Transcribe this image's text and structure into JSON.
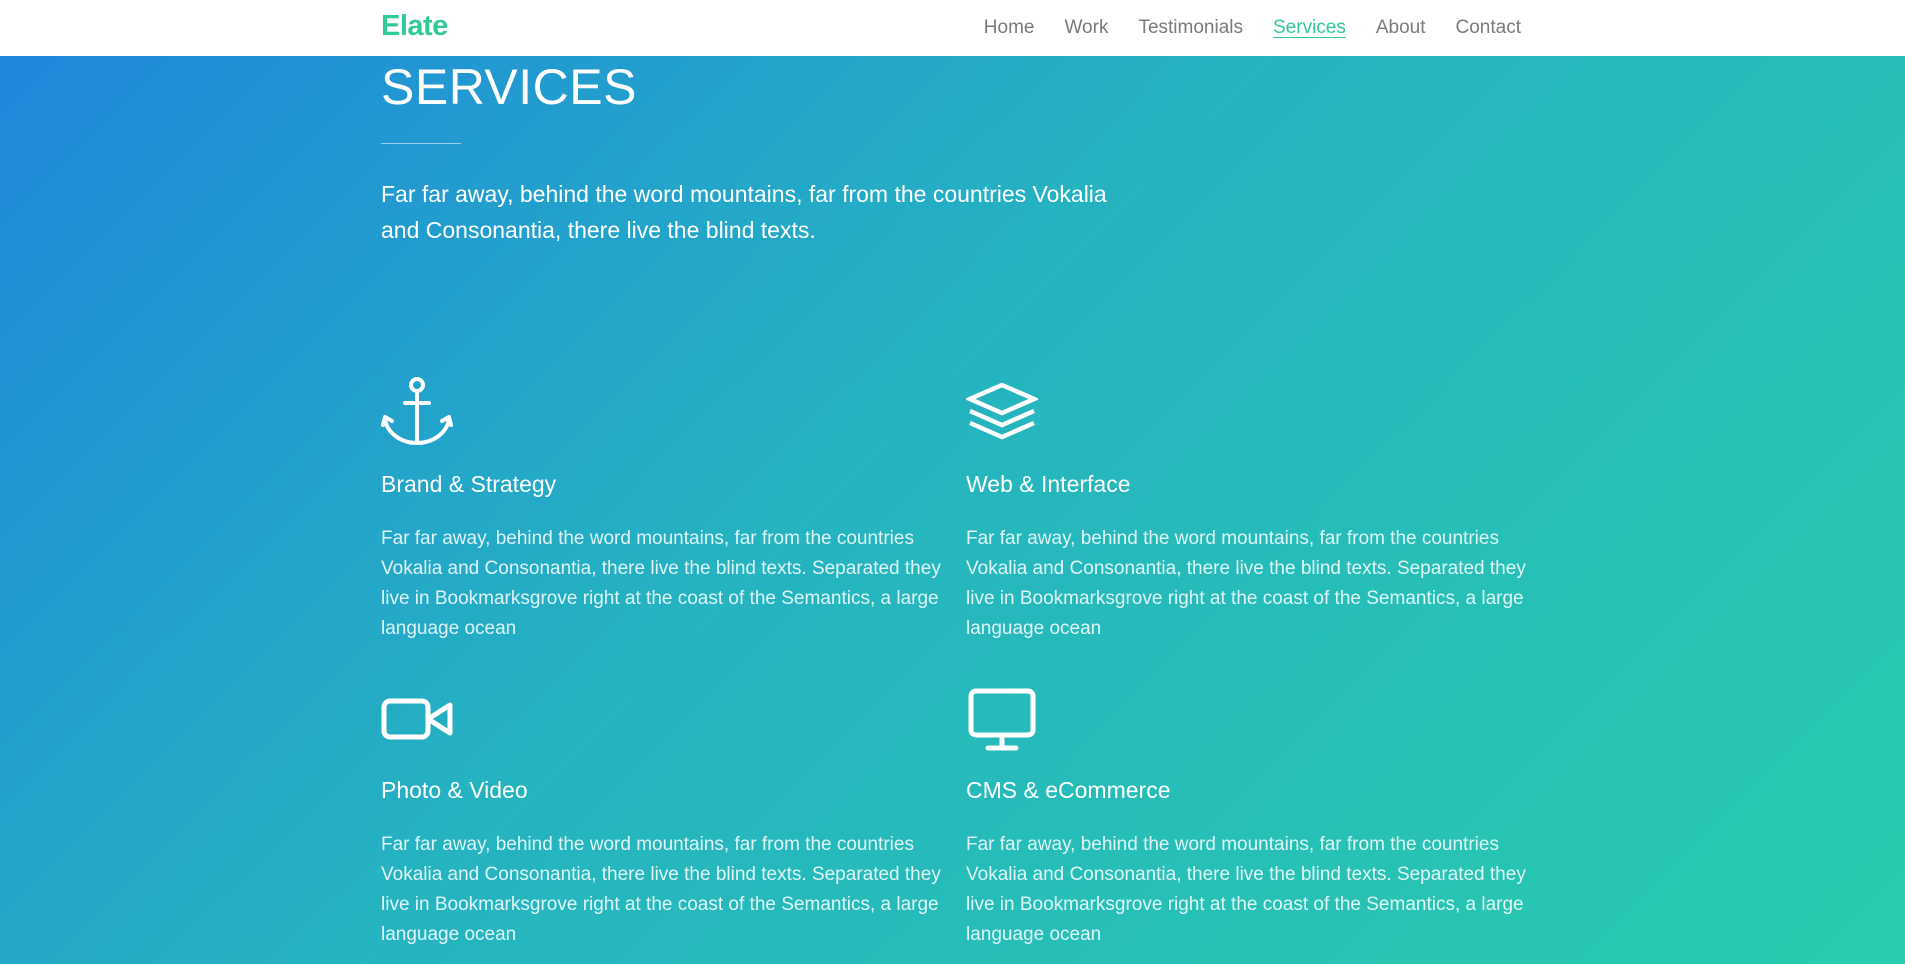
{
  "nav": {
    "brand": "Elate",
    "links": [
      "Home",
      "Work",
      "Testimonials",
      "Services",
      "About",
      "Contact"
    ],
    "active": "Services",
    "accent_color": "#2fca97"
  },
  "section": {
    "title": "SERVICES",
    "lead": "Far far away, behind the word mountains, far from the countries Vokalia and Consonantia, there live the blind texts."
  },
  "services": [
    {
      "icon": "anchor-icon",
      "title": "Brand & Strategy",
      "text": "Far far away, behind the word mountains, far from the countries Vokalia and Consonantia, there live the blind texts. Separated they live in Bookmarksgrove right at the coast of the Semantics, a large language ocean"
    },
    {
      "icon": "layers-icon",
      "title": "Web & Interface",
      "text": "Far far away, behind the word mountains, far from the countries Vokalia and Consonantia, there live the blind texts. Separated they live in Bookmarksgrove right at the coast of the Semantics, a large language ocean"
    },
    {
      "icon": "video-camera-icon",
      "title": "Photo & Video",
      "text": "Far far away, behind the word mountains, far from the countries Vokalia and Consonantia, there live the blind texts. Separated they live in Bookmarksgrove right at the coast of the Semantics, a large language ocean"
    },
    {
      "icon": "monitor-icon",
      "title": "CMS & eCommerce",
      "text": "Far far away, behind the word mountains, far from the countries Vokalia and Consonantia, there live the blind texts. Separated they live in Bookmarksgrove right at the coast of the Semantics, a large language ocean"
    }
  ]
}
